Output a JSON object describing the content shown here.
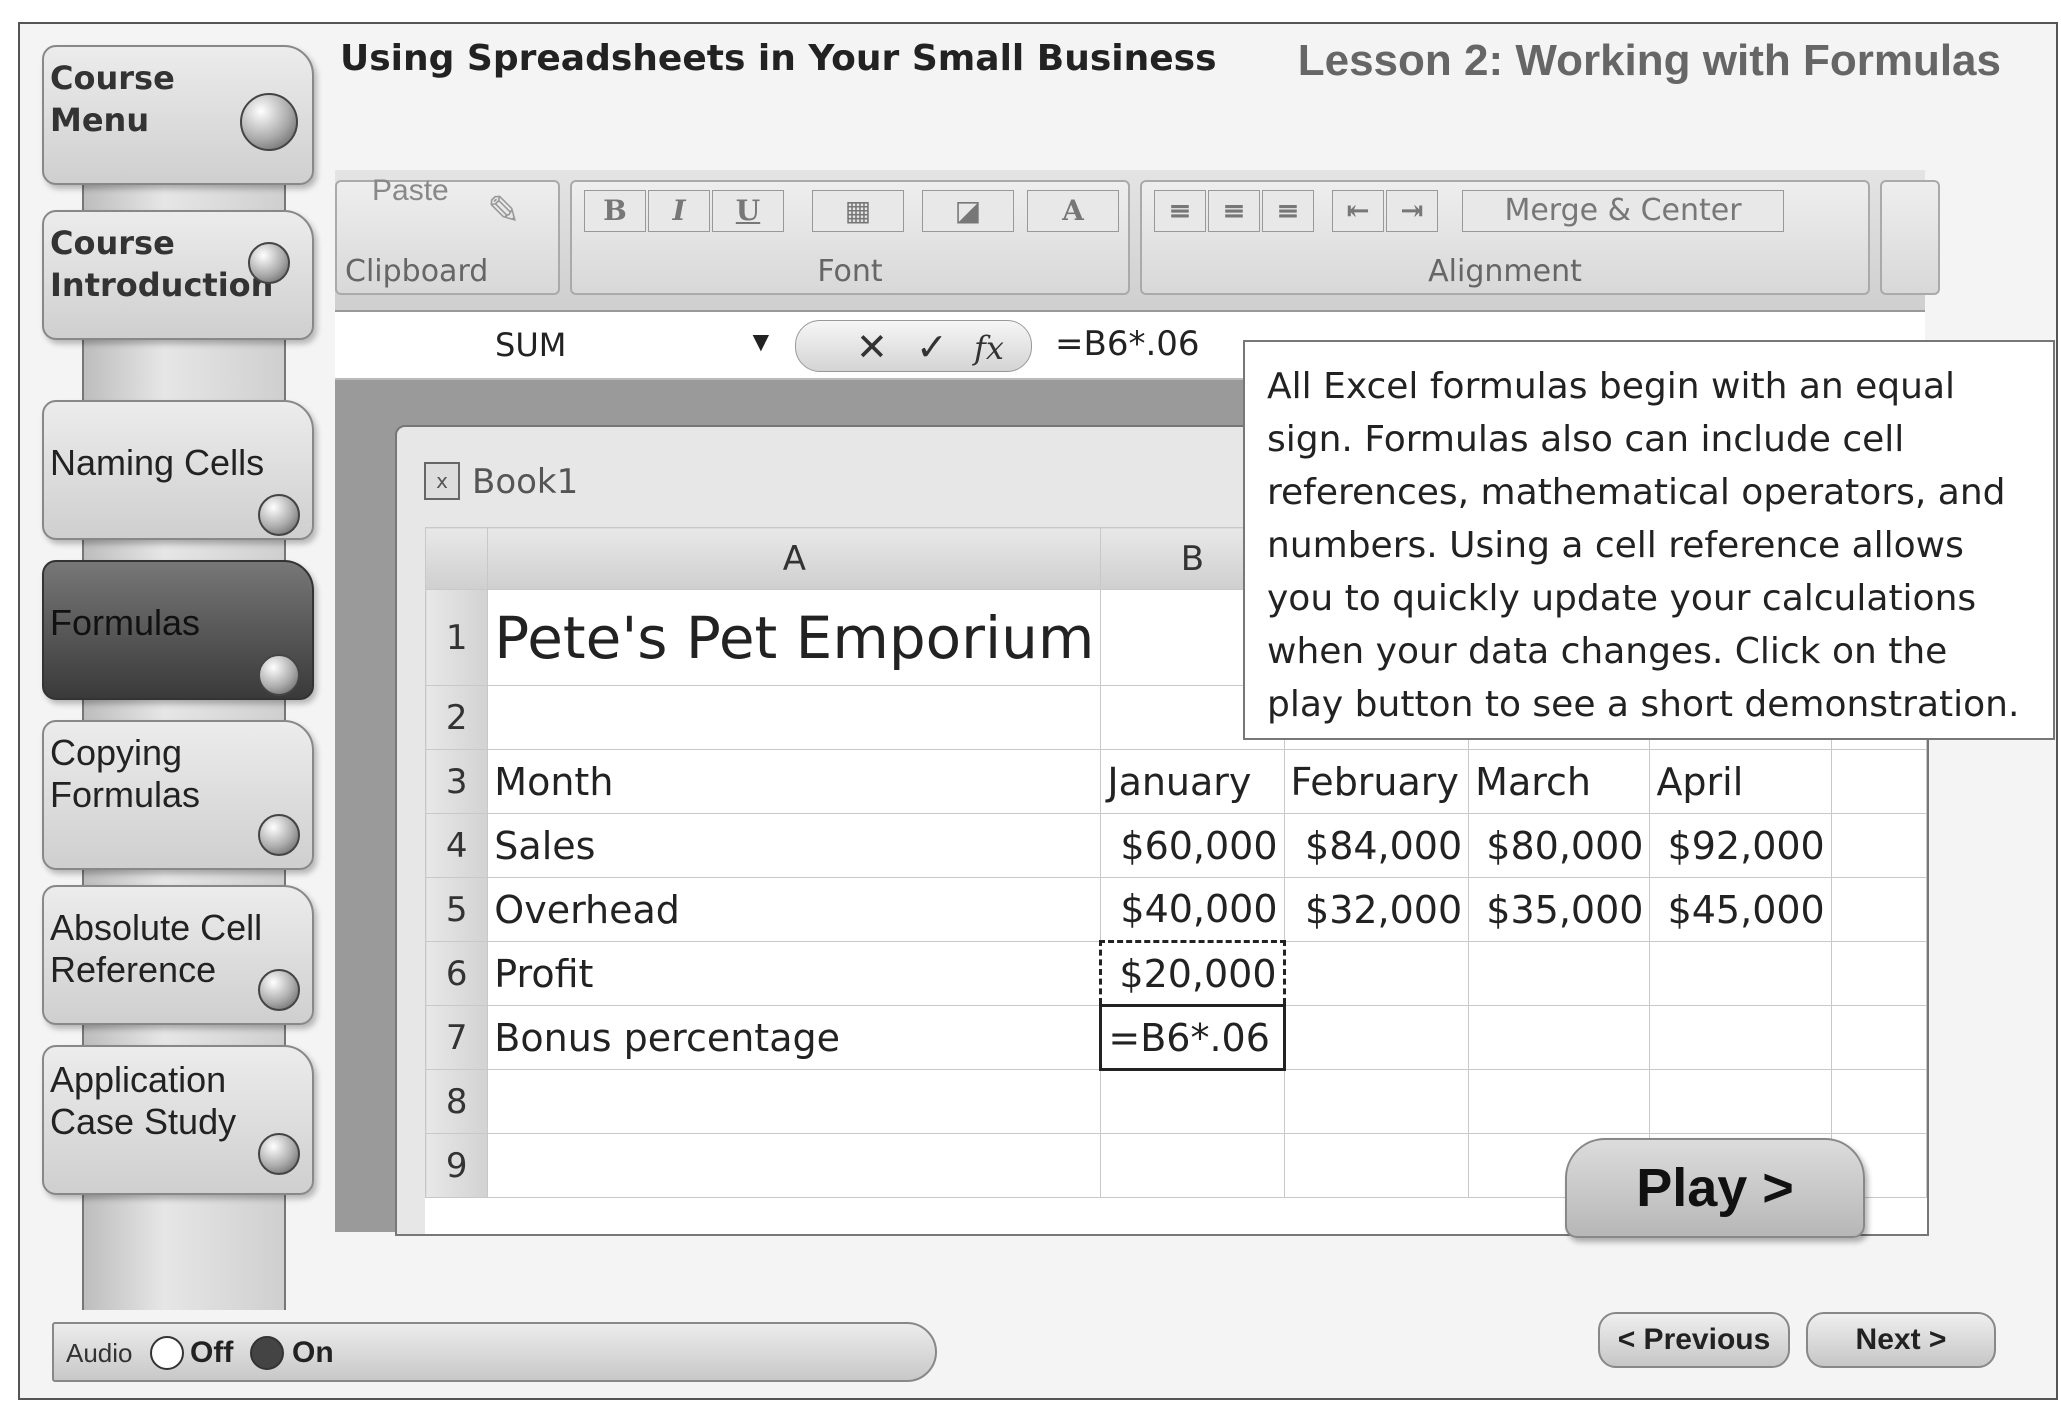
{
  "header": {
    "course_title": "Using Spreadsheets in Your Small Business",
    "lesson_title": "Lesson 2: Working with Formulas"
  },
  "menu": {
    "items": [
      {
        "label": "Course\nMenu",
        "id": "course-menu"
      },
      {
        "label": "Course\nIntroduction",
        "id": "course-introduction"
      },
      {
        "label": "Naming Cells",
        "id": "naming-cells"
      },
      {
        "label": "Formulas",
        "id": "formulas"
      },
      {
        "label": "Copying\nFormulas",
        "id": "copying-formulas"
      },
      {
        "label": "Absolute Cell\nReference",
        "id": "absolute-cell-reference"
      },
      {
        "label": "Application\nCase Study",
        "id": "application-case-study"
      }
    ],
    "active": "formulas"
  },
  "ribbon": {
    "clipboard_group": "Clipboard",
    "font_group": "Font",
    "alignment_group": "Alignment",
    "paste_label": "Paste",
    "merge_center_label": "Merge & Center"
  },
  "formula_bar": {
    "name_box": "SUM",
    "formula": "=B6*.06",
    "cancel_glyph": "✕",
    "enter_glyph": "✓",
    "fx_glyph": "fx"
  },
  "workbook": {
    "title": "Book1",
    "columns": [
      "A",
      "B"
    ],
    "rows": [
      {
        "n": "1",
        "a": "Pete's Pet Emporium",
        "b": "",
        "c": "",
        "d": "",
        "e": ""
      },
      {
        "n": "2",
        "a": "",
        "b": "",
        "c": "",
        "d": "",
        "e": ""
      },
      {
        "n": "3",
        "a": "Month",
        "b": "January",
        "c": "February",
        "d": "March",
        "e": "April"
      },
      {
        "n": "4",
        "a": "Sales",
        "b": "$60,000",
        "c": "$84,000",
        "d": "$80,000",
        "e": "$92,000"
      },
      {
        "n": "5",
        "a": "Overhead",
        "b": "$40,000",
        "c": "$32,000",
        "d": "$35,000",
        "e": "$45,000"
      },
      {
        "n": "6",
        "a": "Profit",
        "b": "$20,000",
        "c": "",
        "d": "",
        "e": ""
      },
      {
        "n": "7",
        "a": "Bonus percentage",
        "b": "=B6*.06",
        "c": "",
        "d": "",
        "e": ""
      },
      {
        "n": "8",
        "a": "",
        "b": "",
        "c": "",
        "d": "",
        "e": ""
      },
      {
        "n": "9",
        "a": "",
        "b": "",
        "c": "",
        "d": "",
        "e": ""
      }
    ]
  },
  "tooltip": {
    "text": "All Excel formulas begin with an equal sign.  Formulas also can include cell references, mathematical operators, and numbers. Using a cell reference allows you to quickly update your calculations when your data changes. Click on the play button to see a short demonstration."
  },
  "play_button": "Play >",
  "audio": {
    "label": "Audio",
    "off_label": "Off",
    "on_label": "On",
    "selected": "On"
  },
  "nav": {
    "previous": "< Previous",
    "next": "Next >"
  }
}
